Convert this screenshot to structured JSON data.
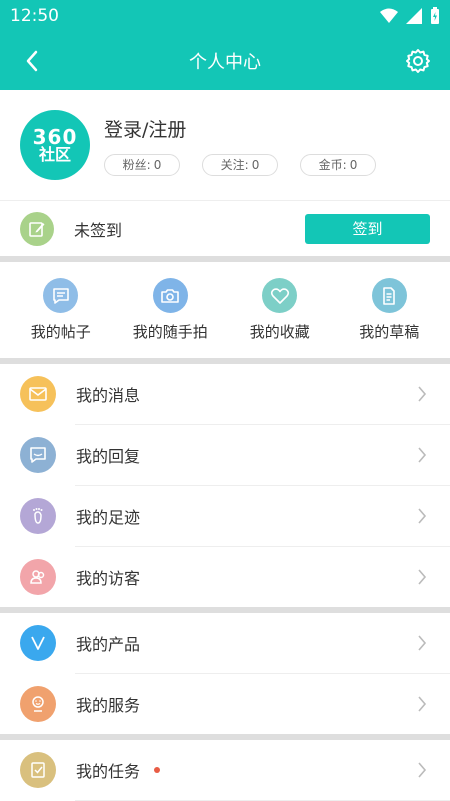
{
  "status": {
    "time": "12:50"
  },
  "header": {
    "title": "个人中心"
  },
  "profile": {
    "logo": {
      "top": "360",
      "bottom": "社区"
    },
    "login": "登录/注册",
    "stats": [
      {
        "label": "粉丝:",
        "value": "0"
      },
      {
        "label": "关注:",
        "value": "0"
      },
      {
        "label": "金币:",
        "value": "0"
      }
    ]
  },
  "checkin": {
    "status": "未签到",
    "button": "签到"
  },
  "quick": [
    {
      "label": "我的帖子",
      "color": "#8fbde7"
    },
    {
      "label": "我的随手拍",
      "color": "#7fb4e8"
    },
    {
      "label": "我的收藏",
      "color": "#7dcfc7"
    },
    {
      "label": "我的草稿",
      "color": "#7ec4d9"
    }
  ],
  "menu1": [
    {
      "label": "我的消息",
      "color": "#f6c15a"
    },
    {
      "label": "我的回复",
      "color": "#8db1d4"
    },
    {
      "label": "我的足迹",
      "color": "#b4a7d6"
    },
    {
      "label": "我的访客",
      "color": "#f2a5aa"
    }
  ],
  "menu2": [
    {
      "label": "我的产品",
      "color": "#3aa8ee"
    },
    {
      "label": "我的服务",
      "color": "#f0a16e"
    }
  ],
  "menu3": [
    {
      "label": "我的任务",
      "color": "#d9c07e"
    }
  ],
  "colors": {
    "primary": "#13c6b6",
    "badge": "#e85c45"
  }
}
